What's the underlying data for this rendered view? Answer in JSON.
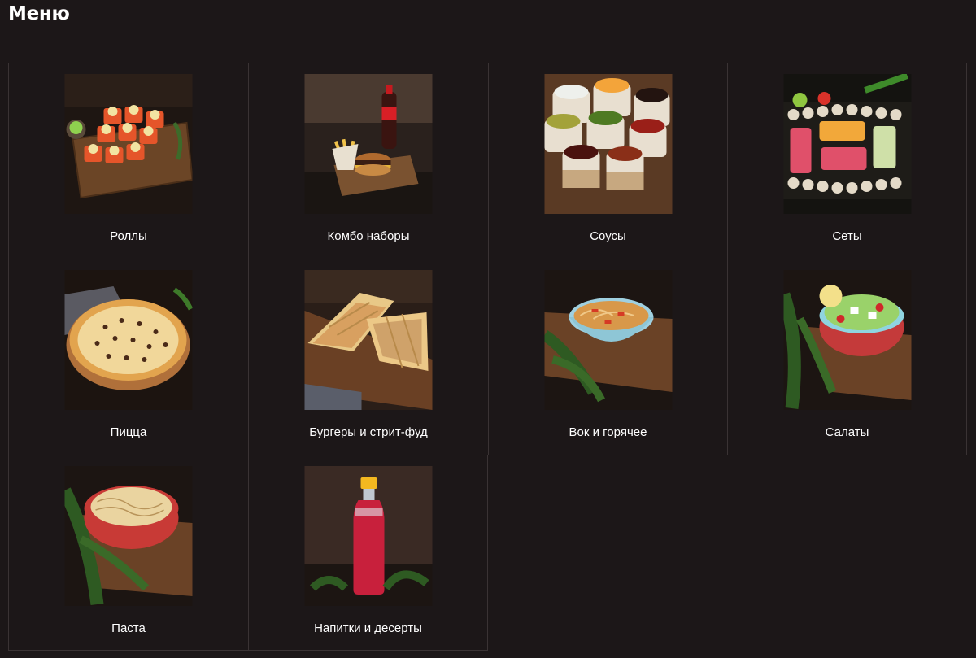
{
  "page": {
    "title": "Меню"
  },
  "categories": [
    {
      "label": "Роллы",
      "icon": "rolls-image"
    },
    {
      "label": "Комбо наборы",
      "icon": "combo-image"
    },
    {
      "label": "Соусы",
      "icon": "sauces-image"
    },
    {
      "label": "Сеты",
      "icon": "sushi-sets-image"
    },
    {
      "label": "Пицца",
      "icon": "pizza-image"
    },
    {
      "label": "Бургеры и стрит-фуд",
      "icon": "shawarma-image"
    },
    {
      "label": "Вок и горячее",
      "icon": "wok-image"
    },
    {
      "label": "Салаты",
      "icon": "salad-image"
    },
    {
      "label": "Паста",
      "icon": "pasta-image"
    },
    {
      "label": "Напитки и десерты",
      "icon": "drink-bottle-image"
    }
  ],
  "colors": {
    "background": "#1c1718",
    "grid_line": "#3a3334",
    "text": "#ffffff"
  }
}
